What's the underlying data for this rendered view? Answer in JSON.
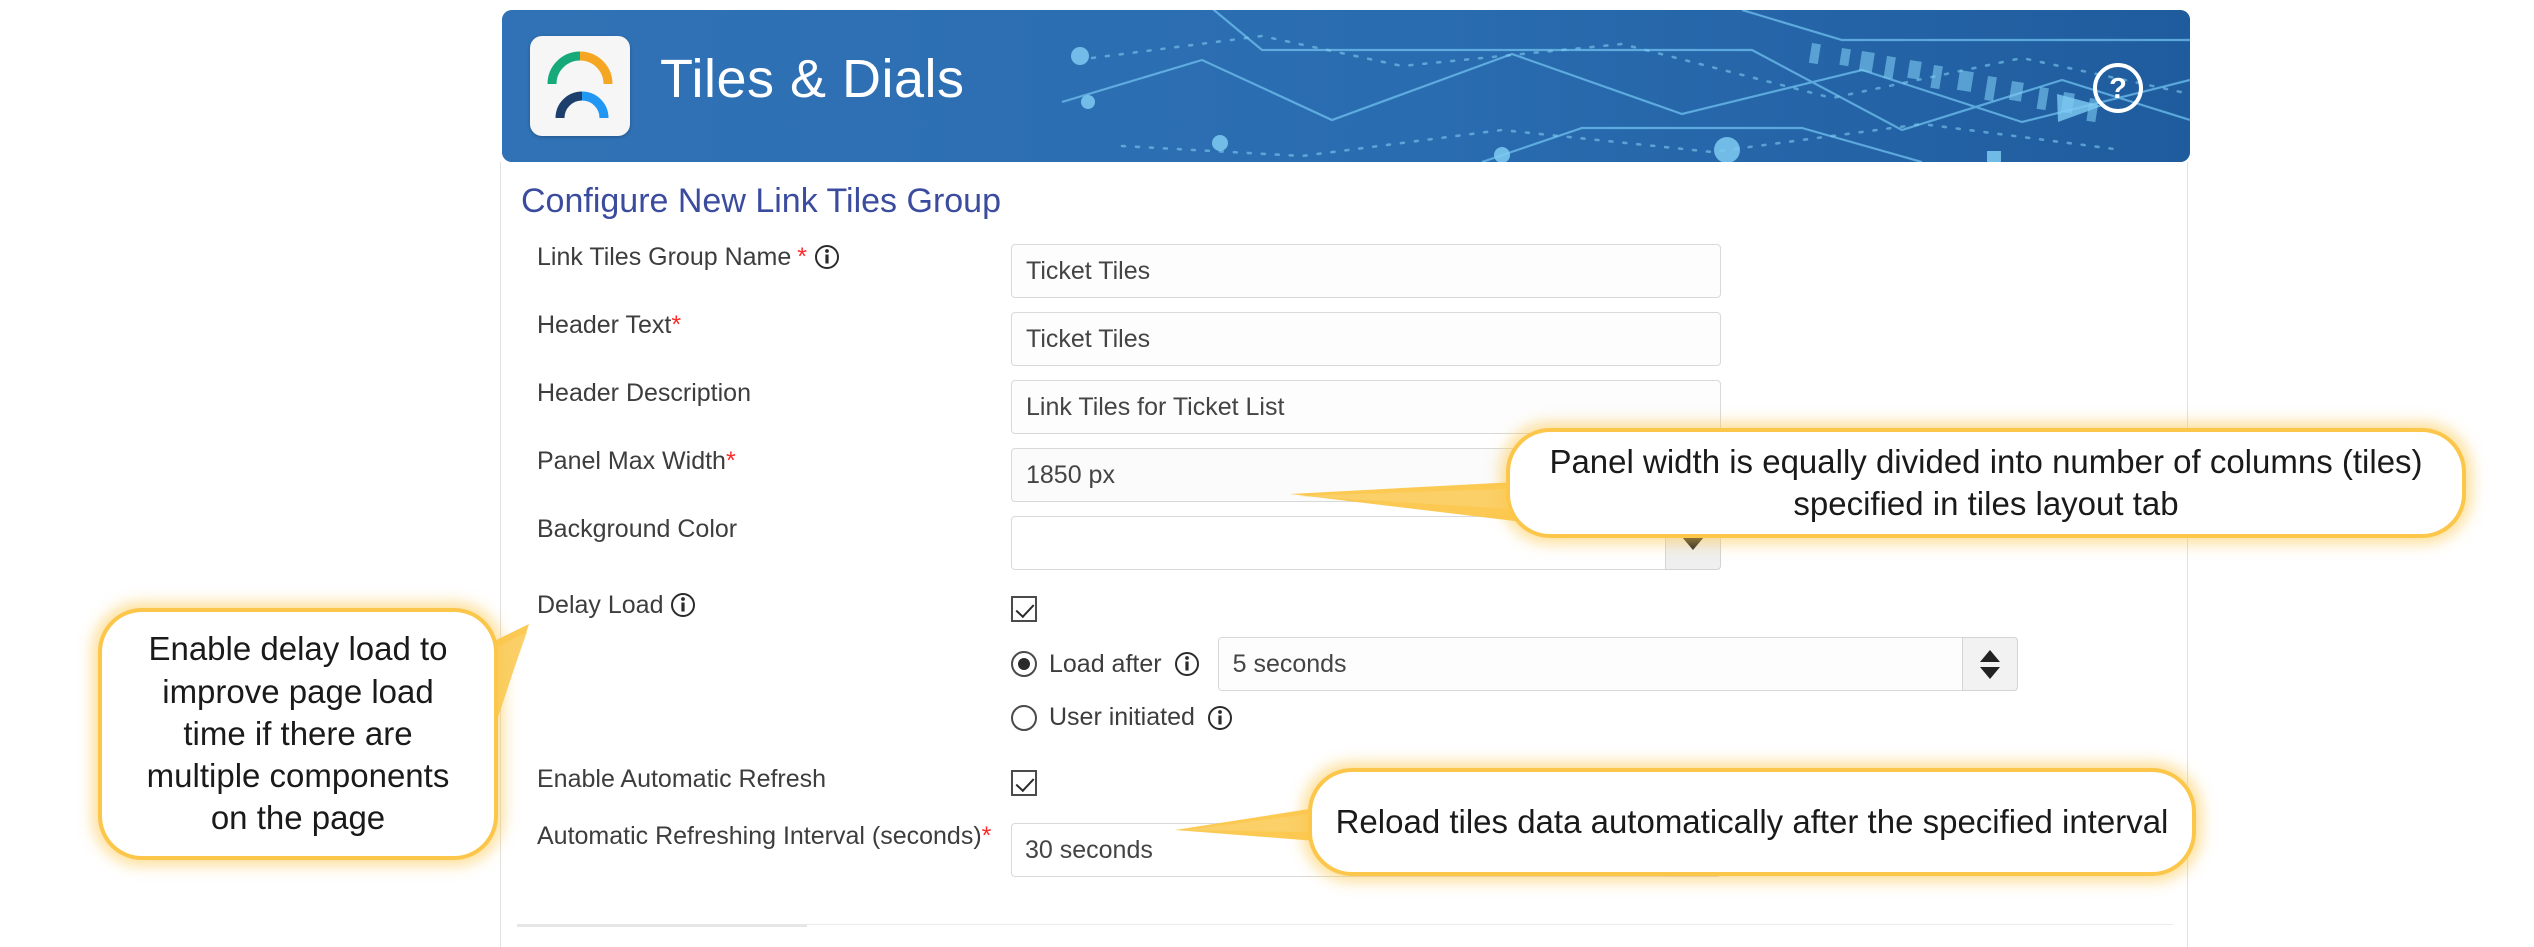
{
  "banner": {
    "title": "Tiles & Dials",
    "logo_icon": "gauge-arcs-logo",
    "help_icon": "question-circle-icon",
    "bg_color": "#2f74b8",
    "logo_colors": {
      "arc_top_left": "#16a97a",
      "arc_top_right": "#f5a623",
      "arc_bottom_left": "#1c3f6e",
      "arc_bottom_right": "#2196f3"
    }
  },
  "panel": {
    "title": "Configure New Link Tiles Group",
    "title_color": "#3b4c9e"
  },
  "form": {
    "fields": [
      {
        "label": "Link Tiles Group Name",
        "required": true,
        "required_spaced": true,
        "info_icon": "info-circle-icon",
        "type": "text",
        "value": "Ticket Tiles",
        "placeholder": ""
      },
      {
        "label": "Header Text",
        "required": true,
        "required_spaced": false,
        "info_icon": null,
        "type": "text",
        "value": "Ticket Tiles",
        "placeholder": ""
      },
      {
        "label": "Header Description",
        "required": false,
        "required_spaced": false,
        "info_icon": null,
        "type": "text",
        "value": "Link Tiles for Ticket List",
        "placeholder": ""
      },
      {
        "label": "Panel Max Width",
        "required": true,
        "required_spaced": false,
        "info_icon": null,
        "type": "text",
        "value": "1850 px",
        "placeholder": ""
      },
      {
        "label": "Background Color",
        "required": false,
        "required_spaced": false,
        "info_icon": null,
        "type": "select",
        "value": "",
        "placeholder": ""
      }
    ],
    "delay_load": {
      "label": "Delay Load",
      "info_icon": "info-circle-icon",
      "checkbox_checked": true,
      "options": [
        {
          "label": "Load after",
          "info_icon": "info-circle-icon",
          "selected": true,
          "value": "5 seconds"
        },
        {
          "label": "User initiated",
          "info_icon": "info-circle-icon",
          "selected": false,
          "value": null
        }
      ]
    },
    "auto_refresh": {
      "label": "Enable Automatic Refresh",
      "checkbox_checked": true
    },
    "refresh_interval": {
      "label": "Automatic Refreshing Interval (seconds)",
      "required": true,
      "value": "30 seconds"
    }
  },
  "callouts": [
    {
      "id": "panel-width-callout",
      "text": "Panel width is equally divided into number of columns (tiles) specified in tiles layout tab"
    },
    {
      "id": "delay-load-callout",
      "text": "Enable delay load to improve page load time if there are multiple components on the page"
    },
    {
      "id": "auto-refresh-callout",
      "text": "Reload tiles data automatically after the specified interval"
    }
  ],
  "colors": {
    "callout_border": "#fcc64a",
    "required_marker": "#ff2a2a",
    "header_blue": "#2f74b8",
    "panel_title_blue": "#3b4c9e"
  }
}
